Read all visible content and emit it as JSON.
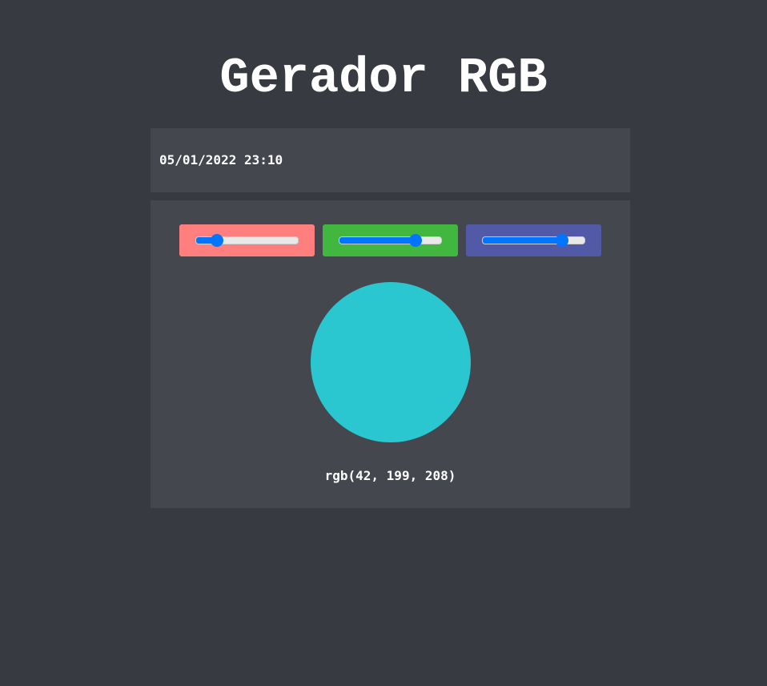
{
  "title": "Gerador RGB",
  "datetime": "05/01/2022 23:10",
  "sliders": [
    {
      "channel": "red",
      "value": 42,
      "max": 255,
      "color": "#ff7f7f"
    },
    {
      "channel": "green",
      "value": 199,
      "max": 255,
      "color": "#41b73f"
    },
    {
      "channel": "blue",
      "value": 208,
      "max": 255,
      "color": "#525aa8"
    }
  ],
  "preview_color": "#2ac7d0",
  "rgb_text": "rgb(42, 199, 208)"
}
